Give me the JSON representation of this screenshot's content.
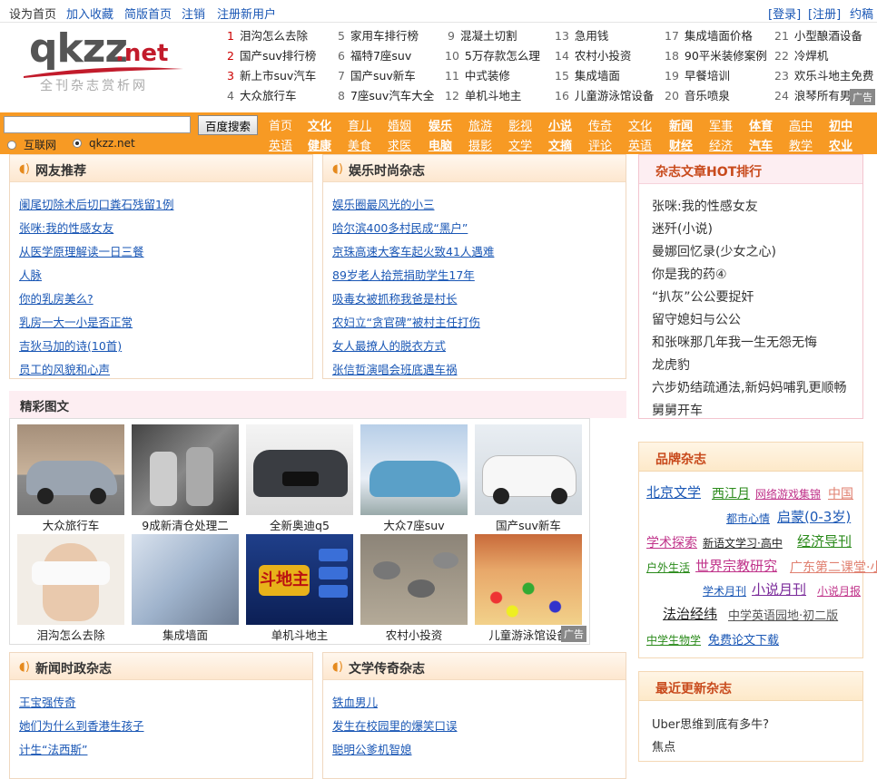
{
  "topbar": {
    "left_links": [
      "设为首页",
      "加入收藏",
      "简版首页",
      "注销",
      "注册新用户"
    ],
    "right_links": [
      "[登录]",
      "[注册]",
      "约稿"
    ]
  },
  "logo": {
    "text": "qkzz",
    "tld": ".net",
    "slogan": "全刊杂志赏析网"
  },
  "hot_keywords": [
    {
      "n": "1",
      "t": "泪沟怎么去除"
    },
    {
      "n": "2",
      "t": "国产suv排行榜"
    },
    {
      "n": "3",
      "t": "新上市suv汽车"
    },
    {
      "n": "4",
      "t": "大众旅行车"
    },
    {
      "n": "5",
      "t": "家用车排行榜"
    },
    {
      "n": "6",
      "t": "福特7座suv"
    },
    {
      "n": "7",
      "t": "国产suv新车"
    },
    {
      "n": "8",
      "t": "7座suv汽车大全"
    },
    {
      "n": "9",
      "t": "混凝土切割"
    },
    {
      "n": "10",
      "t": "5万存款怎么理"
    },
    {
      "n": "11",
      "t": "中式装修"
    },
    {
      "n": "12",
      "t": "单机斗地主"
    },
    {
      "n": "13",
      "t": "急用钱"
    },
    {
      "n": "14",
      "t": "农村小投资"
    },
    {
      "n": "15",
      "t": "集成墙面"
    },
    {
      "n": "16",
      "t": "儿童游泳馆设备"
    },
    {
      "n": "17",
      "t": "集成墙面价格"
    },
    {
      "n": "18",
      "t": "90平米装修案例"
    },
    {
      "n": "19",
      "t": "早餐培训"
    },
    {
      "n": "20",
      "t": "音乐喷泉"
    },
    {
      "n": "21",
      "t": "小型酿酒设备"
    },
    {
      "n": "22",
      "t": "冷焊机"
    },
    {
      "n": "23",
      "t": "欢乐斗地主免费"
    },
    {
      "n": "24",
      "t": "浪琴所有男表"
    }
  ],
  "ad_label": "广告",
  "search": {
    "button": "百度搜索",
    "placeholder": "",
    "options": [
      "互联网",
      "qkzz.net"
    ]
  },
  "nav_row1": [
    "首页",
    "文化",
    "育儿",
    "婚姻",
    "娱乐",
    "旅游",
    "影视",
    "小说",
    "传奇",
    "文化",
    "新闻",
    "军事",
    "体育",
    "高中",
    "初中"
  ],
  "nav_row2": [
    "英语",
    "健康",
    "美食",
    "求医",
    "电脑",
    "摄影",
    "文学",
    "文摘",
    "评论",
    "英语",
    "财经",
    "经济",
    "汽车",
    "教学",
    "农业"
  ],
  "netfriend": {
    "title": "网友推荐",
    "items": [
      "阑尾切除术后切口粪石残留1例",
      "张咪:我的性感女友",
      "从医学原理解读一日三餐",
      "人脉",
      "你的乳房美么?",
      "乳房一大一小是否正常",
      "吉狄马加的诗(10首)",
      "员工的风貌和心声"
    ]
  },
  "entertainment": {
    "title": "娱乐时尚杂志",
    "items": [
      "娱乐圈最风光的小三",
      "哈尔滨400多村民成“黑户”",
      "京珠高速大客车起火致41人遇难",
      "89岁老人拾荒捐助学生17年",
      "吸毒女被抓称我爸是村长",
      "农妇立“贪官碑”被村主任打伤",
      "女人最撩人的脱衣方式",
      "张信哲演唱会班底遇车祸"
    ]
  },
  "rank": {
    "title": "杂志文章HOT排行",
    "items": [
      "张咪:我的性感女友",
      "迷歼(小说)",
      "曼娜回忆录(少女之心)",
      "你是我的药④",
      "“扒灰”公公要捉奸",
      "留守媳妇与公公",
      "和张咪那几年我一生无怨无悔",
      "龙虎豹",
      "六步奶结疏通法,新妈妈哺乳更顺畅",
      "舅舅开车"
    ]
  },
  "gallery": {
    "title": "精彩图文",
    "items": [
      "大众旅行车",
      "9成新清仓处理二",
      "全新奥迪q5",
      "大众7座suv",
      "国产suv新车",
      "泪沟怎么去除",
      "集成墙面",
      "单机斗地主",
      "农村小投资",
      "儿童游泳馆设备"
    ]
  },
  "brand": {
    "title": "品牌杂志",
    "items": [
      "北京文学",
      "西江月",
      "网络游戏集锦",
      "中国社区医师",
      "都市心情",
      "启蒙(0-3岁)",
      "学术探索",
      "新语文学习·高中",
      "经济导刊",
      "户外生活",
      "世界宗教研究",
      "广东第二课堂·小学",
      "学术月刊",
      "小说月刊",
      "小说月报",
      "法治经纬",
      "中学英语园地·初二版",
      "中学生物学",
      "免费论文下载"
    ]
  },
  "news": {
    "title": "新闻时政杂志",
    "items": [
      "王宝强传奇",
      "她们为什么到香港生孩子",
      "计生“法西斯”"
    ]
  },
  "literature": {
    "title": "文学传奇杂志",
    "items": [
      "铁血男儿",
      "发生在校园里的爆笑口误",
      "聪明公爹机智媳"
    ]
  },
  "latest": {
    "title": "最近更新杂志",
    "items": [
      "Uber思维到底有多牛?",
      "焦点"
    ]
  },
  "colors": {
    "nav": "#f79a24",
    "link": "#1a57b5",
    "accent": "#c84a1c"
  }
}
